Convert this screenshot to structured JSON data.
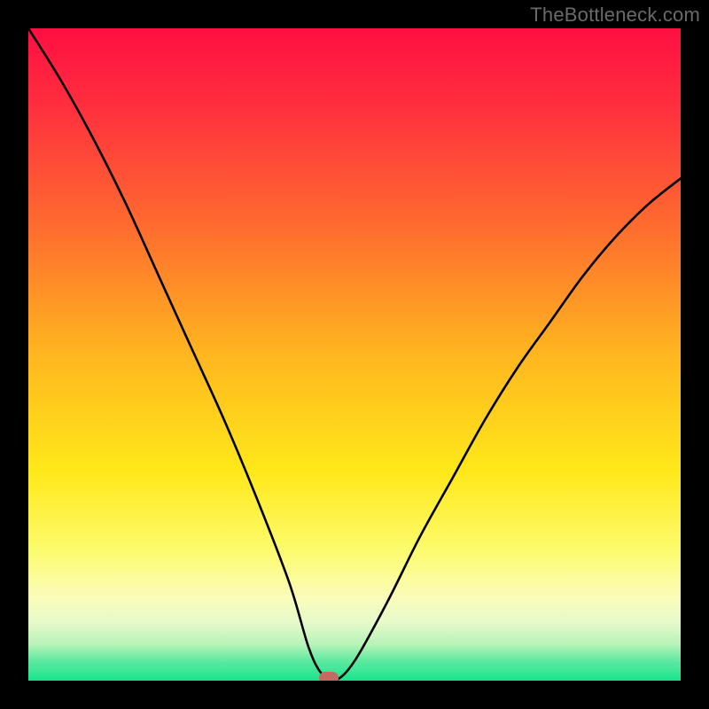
{
  "watermark": "TheBottleneck.com",
  "chart_data": {
    "type": "line",
    "title": "",
    "xlabel": "",
    "ylabel": "",
    "xlim": [
      0,
      100
    ],
    "ylim": [
      0,
      100
    ],
    "grid": false,
    "legend": false,
    "series": [
      {
        "name": "bottleneck-curve",
        "x": [
          0,
          5,
          10,
          15,
          20,
          25,
          30,
          35,
          40,
          43,
          45,
          47,
          50,
          55,
          60,
          65,
          70,
          75,
          80,
          85,
          90,
          95,
          100
        ],
        "values": [
          100,
          92,
          83,
          73,
          62,
          51,
          40,
          28,
          15,
          5,
          1,
          0,
          3,
          12,
          22,
          31,
          40,
          48,
          55,
          62,
          68,
          73,
          77
        ]
      }
    ],
    "marker": {
      "x": 46,
      "y": 0
    },
    "background_gradient": {
      "stops": [
        {
          "offset": 0.0,
          "color": "#ff0f42"
        },
        {
          "offset": 0.12,
          "color": "#ff2f3e"
        },
        {
          "offset": 0.3,
          "color": "#ff6a2f"
        },
        {
          "offset": 0.5,
          "color": "#ffb61f"
        },
        {
          "offset": 0.68,
          "color": "#ffe81a"
        },
        {
          "offset": 0.8,
          "color": "#fdfb6d"
        },
        {
          "offset": 0.87,
          "color": "#fbfcb8"
        },
        {
          "offset": 0.91,
          "color": "#e7faca"
        },
        {
          "offset": 0.945,
          "color": "#b6f3b8"
        },
        {
          "offset": 0.97,
          "color": "#5de9a0"
        },
        {
          "offset": 1.0,
          "color": "#18e58b"
        }
      ]
    }
  }
}
